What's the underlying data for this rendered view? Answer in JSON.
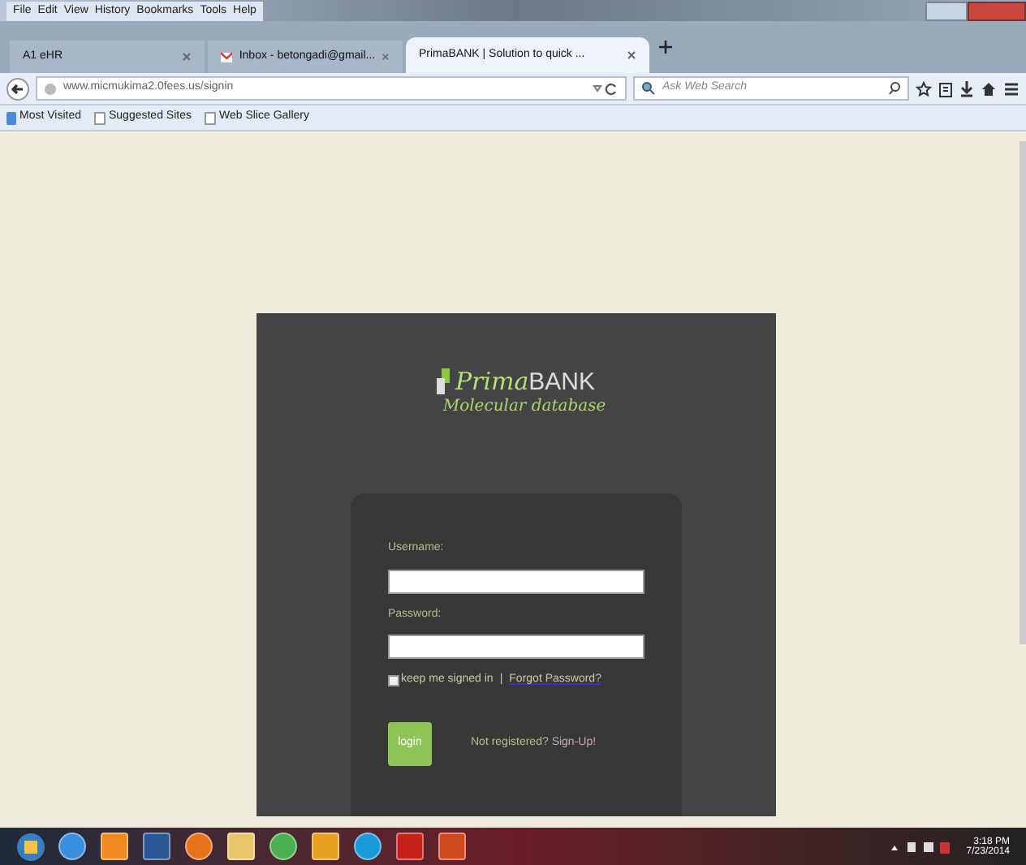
{
  "menu": [
    "File",
    "Edit",
    "View",
    "History",
    "Bookmarks",
    "Tools",
    "Help"
  ],
  "tabs": [
    {
      "label": "A1 eHR",
      "selected": false,
      "kind": "plain"
    },
    {
      "label": "Inbox - betongadi@gmail...",
      "selected": false,
      "kind": "mail"
    },
    {
      "label": "PrimaBANK | Solution to quick ...",
      "selected": true,
      "kind": "plain"
    }
  ],
  "address": {
    "value": "www.micmukima2.0fees.us/signin"
  },
  "search": {
    "placeholder": "Ask Web Search"
  },
  "bookmarks": [
    "Most Visited",
    "Suggested Sites",
    "Web Slice Gallery"
  ],
  "logo": {
    "brand_italic": "Prima",
    "brand": "BANK",
    "tagline": "Molecular database"
  },
  "login": {
    "username_label": "Username:",
    "password_label": "Password:",
    "remember": {
      "label": "keep me signed in",
      "checked": false
    },
    "separator": "|",
    "forgot": "Forgot Password?",
    "button": "login",
    "register_text": "Not registered?",
    "register_link": "Sign-Up!"
  },
  "clock": {
    "time": "3:18 PM",
    "date": "7/23/2014"
  }
}
